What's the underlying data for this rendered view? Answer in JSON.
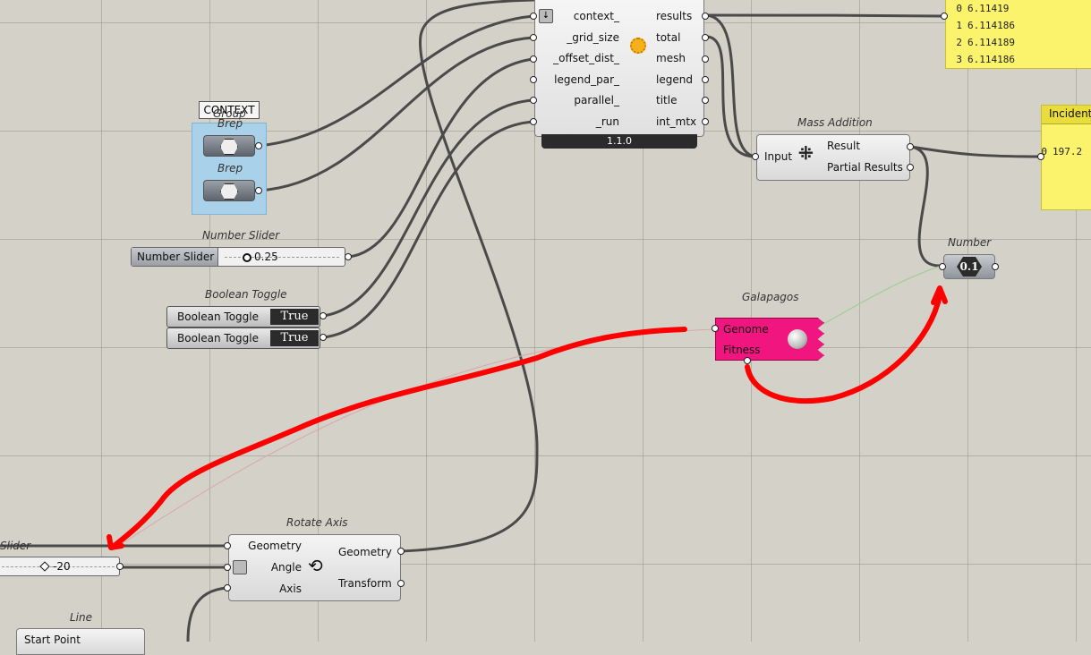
{
  "colors": {
    "canvas": "#d4d1c8",
    "panel_fill": "#fbf36b",
    "galapagos_fill": "#f0157f",
    "group_fill": "#a9d1ea",
    "annotation_red": "#ff0000",
    "wire": "#4a4a4a"
  },
  "main_component": {
    "inputs": [
      "context_",
      "_grid_size",
      "_offset_dist_",
      "legend_par_",
      "parallel_",
      "_run"
    ],
    "outputs": [
      "results",
      "total",
      "mesh",
      "legend",
      "title",
      "int_mtx"
    ],
    "version": "1.1.0",
    "icon": "sun-icon",
    "expander_icon": "down-arrow-icon"
  },
  "results_panel": {
    "rows": [
      {
        "index": "0",
        "value": "6.11419"
      },
      {
        "index": "1",
        "value": "6.114186"
      },
      {
        "index": "2",
        "value": "6.114189"
      },
      {
        "index": "3",
        "value": "6.114186"
      }
    ]
  },
  "incident_panel": {
    "title": "Incident",
    "rows": [
      {
        "index": "0",
        "value": "197.2"
      }
    ]
  },
  "mass_addition": {
    "title": "Mass Addition",
    "input": "Input",
    "outputs": [
      "Result",
      "Partial Results"
    ],
    "icon": "mass-addition-icon"
  },
  "number_param": {
    "title": "Number",
    "icon_text": "0.1"
  },
  "galapagos": {
    "title": "Galapagos",
    "inputs": [
      "Genome",
      "Fitness"
    ],
    "icon": "galapagos-icon"
  },
  "group": {
    "label": "CONTEXT",
    "sub": "Group"
  },
  "breps": [
    {
      "title": "Brep"
    },
    {
      "title": "Brep"
    }
  ],
  "number_slider": {
    "title": "Number Slider",
    "label": "Number Slider",
    "value": "0.25"
  },
  "boolean_toggle": {
    "title": "Boolean Toggle",
    "items": [
      {
        "label": "Boolean Toggle",
        "value": "True"
      },
      {
        "label": "Boolean Toggle",
        "value": "True"
      }
    ]
  },
  "angle_slider": {
    "title": "Slider",
    "value": "-20"
  },
  "rotate_axis": {
    "title": "Rotate Axis",
    "inputs": [
      "Geometry",
      "Angle",
      "Axis"
    ],
    "outputs": [
      "Geometry",
      "Transform"
    ],
    "icon": "rotate-axis-icon"
  },
  "line": {
    "title": "Line",
    "input": "Start Point"
  }
}
